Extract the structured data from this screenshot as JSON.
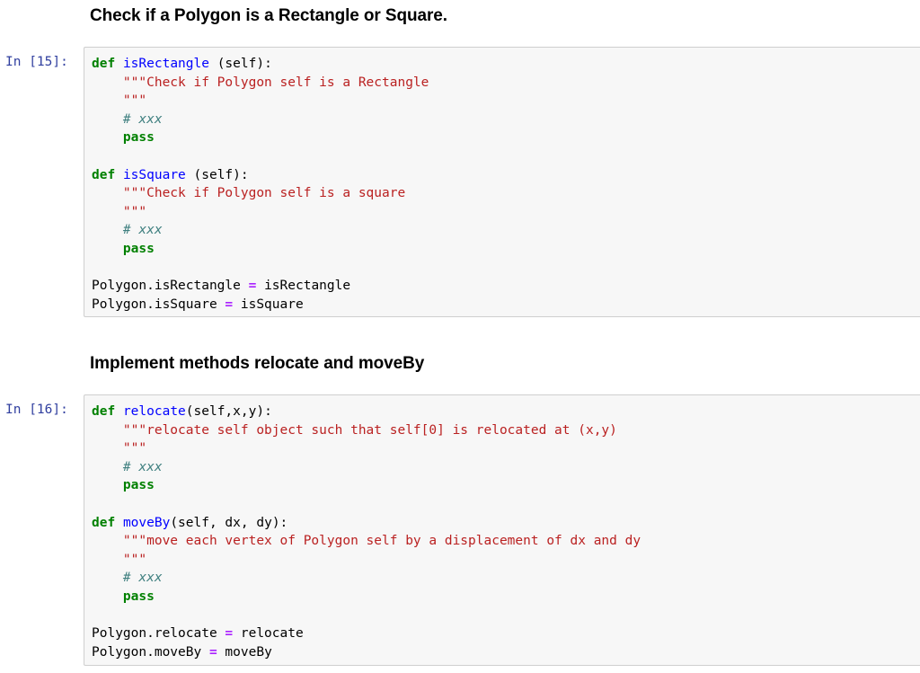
{
  "sections": [
    {
      "heading": "Check if a Polygon is a Rectangle or Square.",
      "prompt": "In [15]:",
      "lines": [
        [
          {
            "t": "kw",
            "v": "def"
          },
          {
            "t": "p",
            "v": " "
          },
          {
            "t": "fn",
            "v": "isRectangle"
          },
          {
            "t": "p",
            "v": " (self):"
          }
        ],
        [
          {
            "t": "p",
            "v": "    "
          },
          {
            "t": "str",
            "v": "\"\"\"Check if Polygon self is a Rectangle"
          }
        ],
        [
          {
            "t": "p",
            "v": "    "
          },
          {
            "t": "str",
            "v": "\"\"\""
          }
        ],
        [
          {
            "t": "p",
            "v": "    "
          },
          {
            "t": "cm",
            "v": "# xxx"
          }
        ],
        [
          {
            "t": "p",
            "v": "    "
          },
          {
            "t": "kw",
            "v": "pass"
          }
        ],
        [],
        [
          {
            "t": "kw",
            "v": "def"
          },
          {
            "t": "p",
            "v": " "
          },
          {
            "t": "fn",
            "v": "isSquare"
          },
          {
            "t": "p",
            "v": " (self):"
          }
        ],
        [
          {
            "t": "p",
            "v": "    "
          },
          {
            "t": "str",
            "v": "\"\"\"Check if Polygon self is a square"
          }
        ],
        [
          {
            "t": "p",
            "v": "    "
          },
          {
            "t": "str",
            "v": "\"\"\""
          }
        ],
        [
          {
            "t": "p",
            "v": "    "
          },
          {
            "t": "cm",
            "v": "# xxx"
          }
        ],
        [
          {
            "t": "p",
            "v": "    "
          },
          {
            "t": "kw",
            "v": "pass"
          }
        ],
        [],
        [
          {
            "t": "p",
            "v": "Polygon.isRectangle "
          },
          {
            "t": "op",
            "v": "="
          },
          {
            "t": "p",
            "v": " isRectangle"
          }
        ],
        [
          {
            "t": "p",
            "v": "Polygon.isSquare "
          },
          {
            "t": "op",
            "v": "="
          },
          {
            "t": "p",
            "v": " isSquare"
          }
        ]
      ]
    },
    {
      "heading": "Implement methods relocate and moveBy",
      "prompt": "In [16]:",
      "lines": [
        [
          {
            "t": "kw",
            "v": "def"
          },
          {
            "t": "p",
            "v": " "
          },
          {
            "t": "fn",
            "v": "relocate"
          },
          {
            "t": "p",
            "v": "(self,x,y):"
          }
        ],
        [
          {
            "t": "p",
            "v": "    "
          },
          {
            "t": "str",
            "v": "\"\"\"relocate self object such that self[0] is relocated at (x,y)"
          }
        ],
        [
          {
            "t": "p",
            "v": "    "
          },
          {
            "t": "str",
            "v": "\"\"\""
          }
        ],
        [
          {
            "t": "p",
            "v": "    "
          },
          {
            "t": "cm",
            "v": "# xxx"
          }
        ],
        [
          {
            "t": "p",
            "v": "    "
          },
          {
            "t": "kw",
            "v": "pass"
          }
        ],
        [],
        [
          {
            "t": "kw",
            "v": "def"
          },
          {
            "t": "p",
            "v": " "
          },
          {
            "t": "fn",
            "v": "moveBy"
          },
          {
            "t": "p",
            "v": "(self, dx, dy):"
          }
        ],
        [
          {
            "t": "p",
            "v": "    "
          },
          {
            "t": "str",
            "v": "\"\"\"move each vertex of Polygon self by a displacement of dx and dy"
          }
        ],
        [
          {
            "t": "p",
            "v": "    "
          },
          {
            "t": "str",
            "v": "\"\"\""
          }
        ],
        [
          {
            "t": "p",
            "v": "    "
          },
          {
            "t": "cm",
            "v": "# xxx"
          }
        ],
        [
          {
            "t": "p",
            "v": "    "
          },
          {
            "t": "kw",
            "v": "pass"
          }
        ],
        [],
        [
          {
            "t": "p",
            "v": "Polygon.relocate "
          },
          {
            "t": "op",
            "v": "="
          },
          {
            "t": "p",
            "v": " relocate"
          }
        ],
        [
          {
            "t": "p",
            "v": "Polygon.moveBy "
          },
          {
            "t": "op",
            "v": "="
          },
          {
            "t": "p",
            "v": " moveBy"
          }
        ]
      ]
    }
  ]
}
